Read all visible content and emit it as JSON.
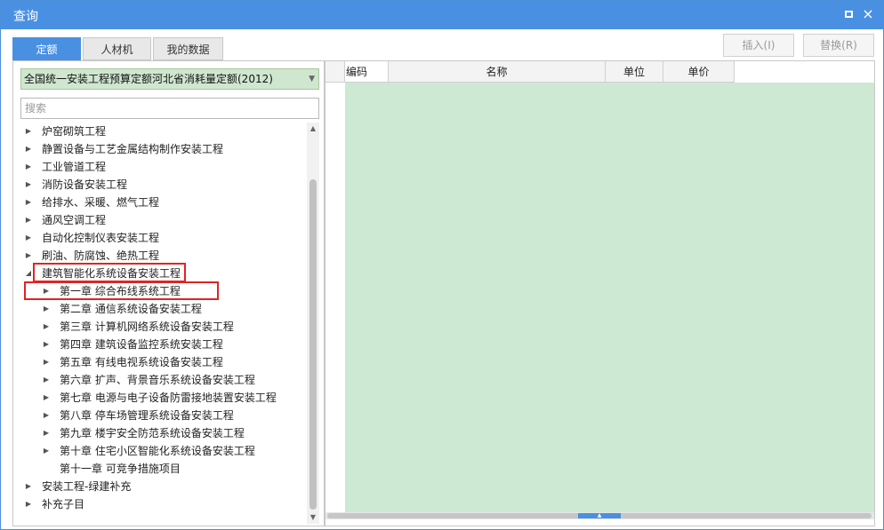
{
  "window": {
    "title": "查询",
    "maximize_icon": "maximize-icon",
    "close_icon": "close-icon",
    "close_glyph": "×"
  },
  "tabs": [
    {
      "label": "定额",
      "active": true
    },
    {
      "label": "人材机",
      "active": false
    },
    {
      "label": "我的数据",
      "active": false
    }
  ],
  "actions": {
    "insert_label": "插入(I)",
    "replace_label": "替换(R)"
  },
  "library": {
    "selected": "全国统一安装工程预算定额河北省消耗量定额(2012)"
  },
  "search": {
    "placeholder": "搜索",
    "value": ""
  },
  "tree": {
    "items": [
      {
        "label": "炉窑砌筑工程",
        "level": 0,
        "expanded": false
      },
      {
        "label": "静置设备与工艺金属结构制作安装工程",
        "level": 0,
        "expanded": false
      },
      {
        "label": "工业管道工程",
        "level": 0,
        "expanded": false
      },
      {
        "label": "消防设备安装工程",
        "level": 0,
        "expanded": false
      },
      {
        "label": "给排水、采暖、燃气工程",
        "level": 0,
        "expanded": false
      },
      {
        "label": "通风空调工程",
        "level": 0,
        "expanded": false
      },
      {
        "label": "自动化控制仪表安装工程",
        "level": 0,
        "expanded": false
      },
      {
        "label": "刷油、防腐蚀、绝热工程",
        "level": 0,
        "expanded": false
      },
      {
        "label": "建筑智能化系统设备安装工程",
        "level": 0,
        "expanded": true
      },
      {
        "label": "第一章 综合布线系统工程",
        "level": 1,
        "expanded": false
      },
      {
        "label": "第二章 通信系统设备安装工程",
        "level": 1,
        "expanded": false
      },
      {
        "label": "第三章 计算机网络系统设备安装工程",
        "level": 1,
        "expanded": false
      },
      {
        "label": "第四章 建筑设备监控系统安装工程",
        "level": 1,
        "expanded": false
      },
      {
        "label": "第五章 有线电视系统设备安装工程",
        "level": 1,
        "expanded": false
      },
      {
        "label": "第六章 扩声、背景音乐系统设备安装工程",
        "level": 1,
        "expanded": false
      },
      {
        "label": "第七章 电源与电子设备防雷接地装置安装工程",
        "level": 1,
        "expanded": false
      },
      {
        "label": "第八章 停车场管理系统设备安装工程",
        "level": 1,
        "expanded": false
      },
      {
        "label": "第九章 楼宇安全防范系统设备安装工程",
        "level": 1,
        "expanded": false
      },
      {
        "label": "第十章 住宅小区智能化系统设备安装工程",
        "level": 1,
        "expanded": false
      },
      {
        "label": "第十一章 可竞争措施项目",
        "level": 1,
        "expanded": false,
        "leaf": true
      },
      {
        "label": "安装工程-绿建补充",
        "level": 0,
        "expanded": false
      },
      {
        "label": "补充子目",
        "level": 0,
        "expanded": false
      }
    ]
  },
  "grid": {
    "columns": [
      "编码",
      "名称",
      "单位",
      "单价"
    ]
  },
  "colors": {
    "accent": "#4a90e2",
    "grid_background": "#cde8d3",
    "highlight": "#e02424",
    "library_select": "#cfe7cf"
  }
}
